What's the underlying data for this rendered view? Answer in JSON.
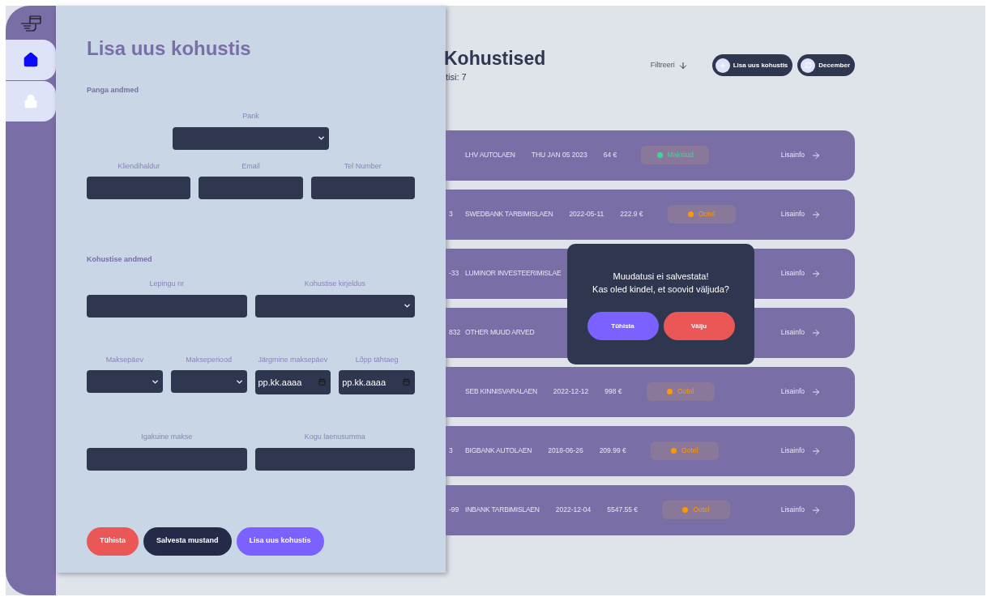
{
  "sidebar": {
    "items": [
      {
        "selected": true
      },
      {
        "selected": false
      }
    ]
  },
  "header": {
    "title": "Kohustised",
    "subtitle": "tisi: 7",
    "filter": "Filtreeri",
    "add_button": "Lisa uus kohustis",
    "month_button": "December"
  },
  "rows": [
    {
      "fragment": "",
      "name": "LHV AUTOLAEN",
      "date": "THU JAN 05 2023",
      "amount": "64 €",
      "status": "Makstud",
      "color": "#3ed598",
      "link": "Lisainfo"
    },
    {
      "fragment": "3",
      "name": "SWEDBANK TARBIMISLAEN",
      "date": "2022-05-11",
      "amount": "222.9 €",
      "status": "Ootel",
      "color": "#ff9800",
      "link": "Lisainfo"
    },
    {
      "fragment": "-33",
      "name": "LUMINOR INVESTEERIMISLAE",
      "link": "Lisainfo"
    },
    {
      "fragment": "832",
      "name": "OTHER MUUD ARVED",
      "link": "Lisainfo"
    },
    {
      "fragment": "",
      "name": "SEB KINNISVARALAEN",
      "date": "2022-12-12",
      "amount": "998 €",
      "status": "Ootel",
      "color": "#ff9800",
      "link": "Lisainfo"
    },
    {
      "fragment": "3",
      "name": "BIGBANK AUTOLAEN",
      "date": "2018-06-26",
      "amount": "209.99 €",
      "status": "Ootel",
      "color": "#ff9800",
      "link": "Lisainfo"
    },
    {
      "fragment": "-99",
      "name": "INBANK TARBIMISLAEN",
      "date": "2022-12-04",
      "amount": "5547.55 €",
      "status": "Ootel",
      "color": "#ff9800",
      "link": "Lisainfo"
    }
  ],
  "form": {
    "title": "Lisa uus kohustis",
    "sections": [
      {
        "heading": "Panga andmed",
        "field": {
          "label": "Pank",
          "kind": "select"
        },
        "rows": [
          [
            {
              "label": "Kliendihaldur",
              "kind": "text"
            },
            {
              "label": "Email",
              "kind": "text"
            },
            {
              "label": "Tel Number",
              "kind": "text"
            }
          ]
        ]
      },
      {
        "heading": "Kohustise andmed",
        "rows": [
          [
            {
              "label": "Lepingu nr",
              "kind": "text"
            },
            {
              "label": "Kohustise kirjeldus",
              "kind": "select"
            }
          ],
          [
            {
              "label": "Maksepäev",
              "kind": "select"
            },
            {
              "label": "Makseperiood",
              "kind": "select"
            },
            {
              "label": "Järgmine maksepäev",
              "kind": "date",
              "placeholder": "pp.kk.aaaa"
            },
            {
              "label": "Lõpp tähtaeg",
              "kind": "date",
              "placeholder": "pp.kk.aaaa"
            }
          ],
          [
            {
              "label": "Igakuine makse",
              "kind": "text"
            },
            {
              "label": "Kogu laenusumma",
              "kind": "text"
            }
          ]
        ]
      }
    ],
    "buttons": [
      {
        "label": "Tühista",
        "kind": "danger"
      },
      {
        "label": "Salvesta mustand",
        "kind": "dark"
      },
      {
        "label": "Lisa uus kohustis",
        "kind": "primary"
      }
    ]
  },
  "dialog": {
    "message": "Muudatusi ei salvestata!\nKas oled kindel, et soovid väljuda?",
    "buttons": [
      {
        "label": "Tühista",
        "kind": "primary"
      },
      {
        "label": "Välju",
        "kind": "danger"
      }
    ]
  }
}
